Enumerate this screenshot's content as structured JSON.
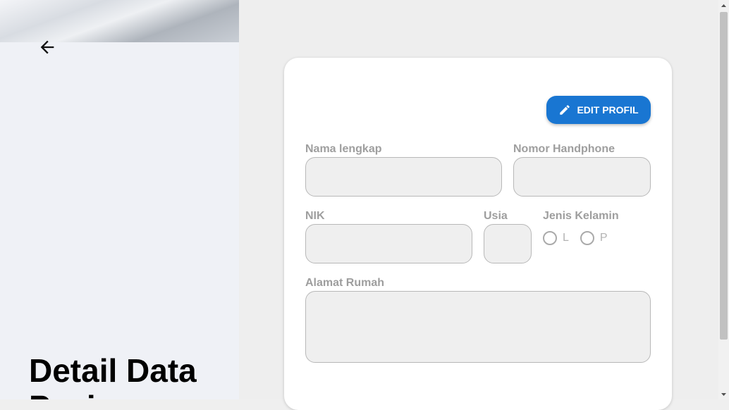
{
  "sidebar": {
    "back_icon": "arrow-left-icon",
    "title": "Detail Data Pasien"
  },
  "card": {
    "edit_button_label": "EDIT PROFIL",
    "edit_icon": "pencil-icon",
    "accent_color": "#1976d2",
    "fields": {
      "nama_label": "Nama lengkap",
      "nama_value": "",
      "phone_label": "Nomor Handphone",
      "phone_value": "",
      "nik_label": "NIK",
      "nik_value": "",
      "usia_label": "Usia",
      "usia_value": "",
      "gender_label": "Jenis Kelamin",
      "gender_options": [
        "L",
        "P"
      ],
      "alamat_label": "Alamat Rumah",
      "alamat_value": ""
    }
  }
}
